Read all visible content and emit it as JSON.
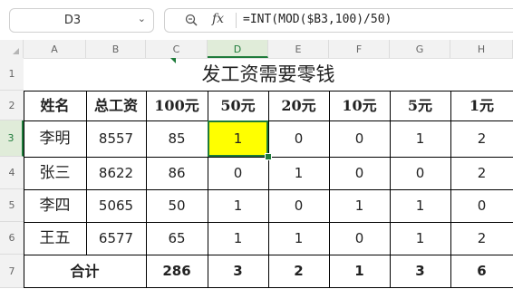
{
  "toolbar": {
    "name_box": "D3",
    "fx_label": "fx",
    "formula": "=INT(MOD($B3,100)/50)"
  },
  "columns": [
    "A",
    "B",
    "C",
    "D",
    "E",
    "F",
    "G",
    "H"
  ],
  "rows": [
    "1",
    "2",
    "3",
    "4",
    "5",
    "6",
    "7"
  ],
  "sheet": {
    "title": "发工资需要零钱",
    "headers": [
      "姓名",
      "总工资",
      "100元",
      "50元",
      "20元",
      "10元",
      "5元",
      "1元"
    ],
    "data": [
      [
        "李明",
        "8557",
        "85",
        "1",
        "0",
        "0",
        "1",
        "2"
      ],
      [
        "张三",
        "8622",
        "86",
        "0",
        "1",
        "0",
        "0",
        "2"
      ],
      [
        "李四",
        "5065",
        "50",
        "1",
        "0",
        "1",
        "1",
        "0"
      ],
      [
        "王五",
        "6577",
        "65",
        "1",
        "1",
        "0",
        "1",
        "2"
      ]
    ],
    "total_label": "合计",
    "totals": [
      "286",
      "3",
      "2",
      "1",
      "3",
      "6"
    ]
  },
  "colors": {
    "accent": "#1e7b3a",
    "selected_fill": "#ffff00"
  }
}
